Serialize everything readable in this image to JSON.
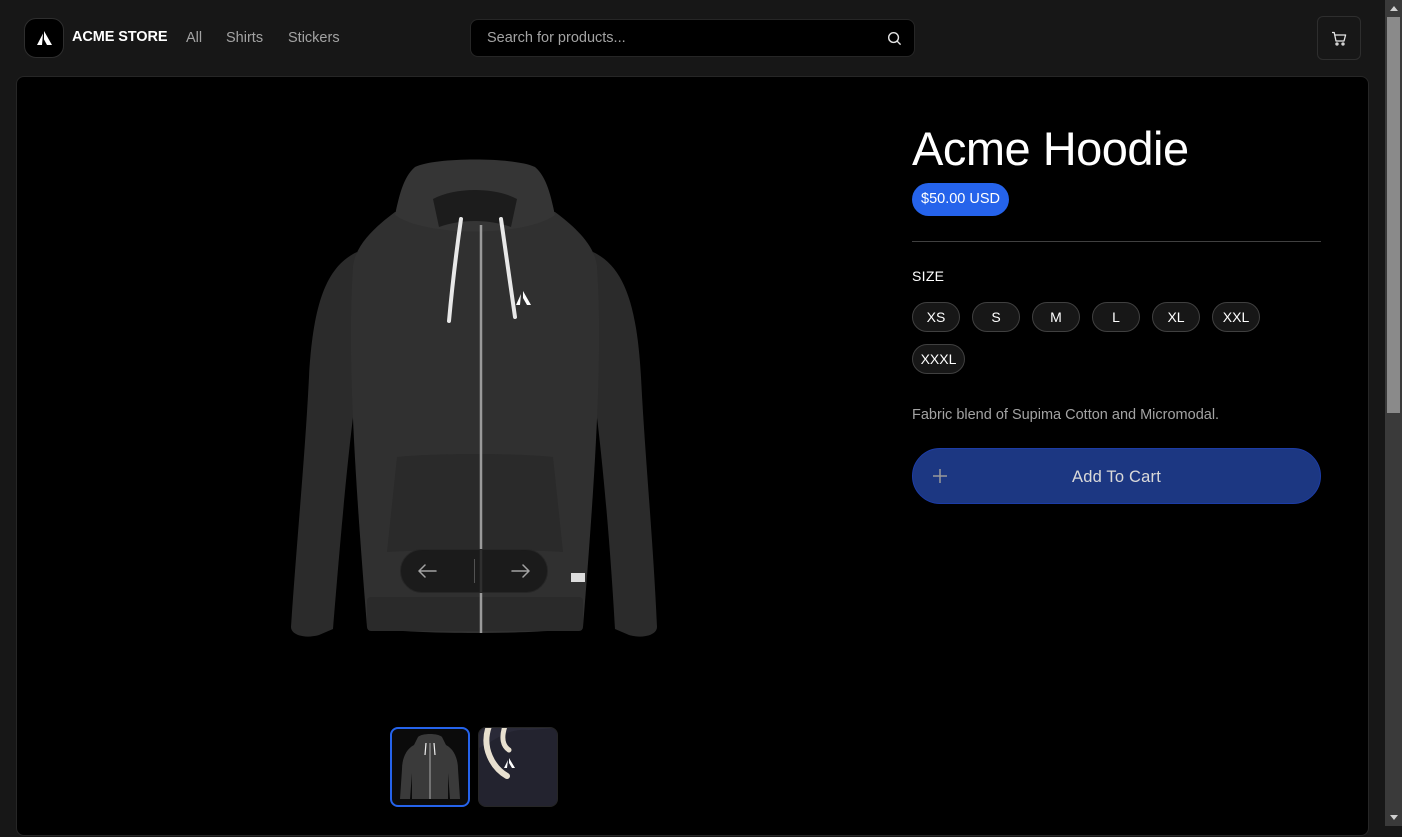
{
  "header": {
    "brand": "ACME STORE",
    "nav": [
      {
        "label": "All"
      },
      {
        "label": "Shirts"
      },
      {
        "label": "Stickers"
      }
    ],
    "search_placeholder": "Search for products..."
  },
  "product": {
    "title": "Acme Hoodie",
    "price": "$50.00 USD",
    "size_label": "SIZE",
    "sizes": [
      "XS",
      "S",
      "M",
      "L",
      "XL",
      "XXL",
      "XXXL"
    ],
    "description": "Fabric blend of Supima Cotton and Micromodal.",
    "add_to_cart_label": "Add To Cart"
  },
  "gallery": {
    "images": [
      {
        "name": "hoodie-front",
        "selected": true
      },
      {
        "name": "hoodie-detail",
        "selected": false
      }
    ]
  },
  "colors": {
    "accent": "#2563eb",
    "cart_button": "#1e3a8a",
    "background": "#171717",
    "panel": "#000000"
  },
  "icons": [
    "acme-logo-icon",
    "search-icon",
    "cart-icon",
    "arrow-left-icon",
    "arrow-right-icon",
    "plus-icon"
  ]
}
